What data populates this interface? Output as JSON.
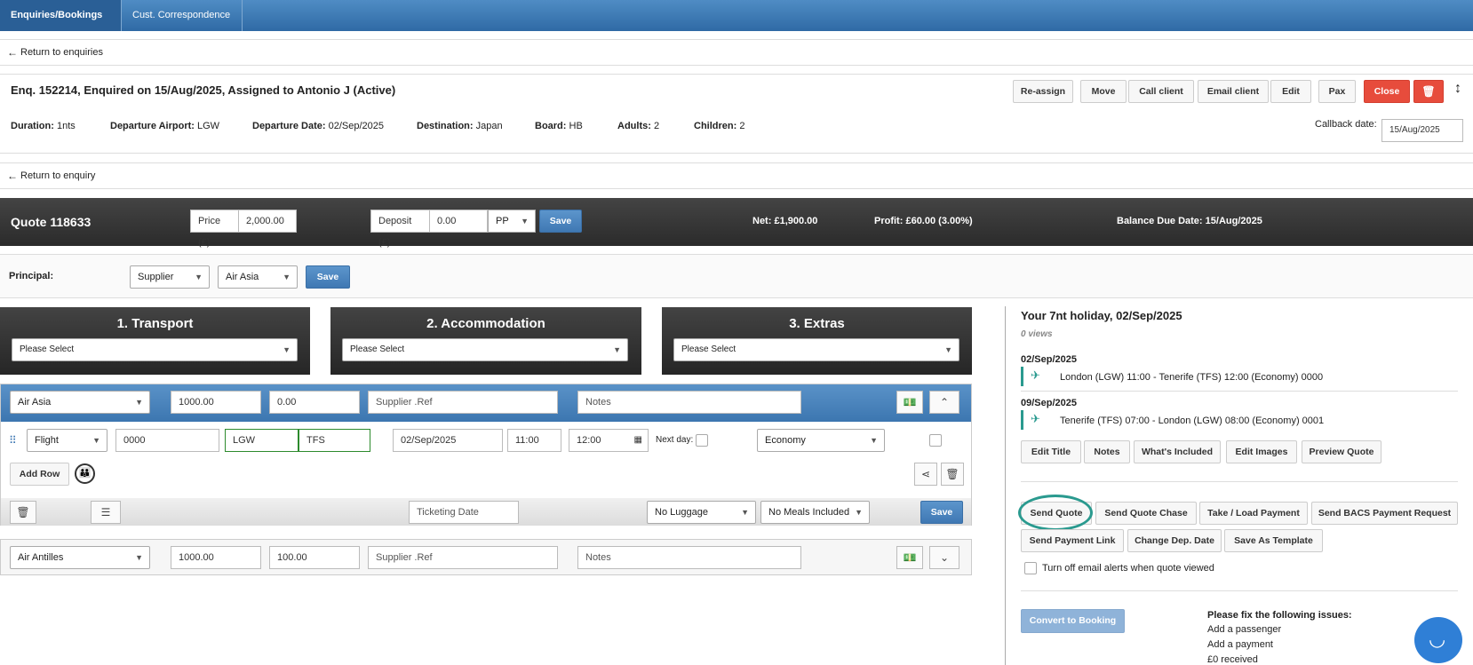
{
  "nav": {
    "tabs": [
      "Enquiries/Bookings",
      "Cust. Correspondence"
    ]
  },
  "return_enquiries": "Return to enquiries",
  "enquiry": {
    "title": "Enq. 152214, Enquired on 15/Aug/2025, Assigned to Antonio J (Active)",
    "buttons": [
      "Re-assign",
      "Move",
      "Call client",
      "Email client",
      "Edit",
      "Pax",
      "Close"
    ],
    "details": [
      {
        "label": "Duration:",
        "value": "1nts"
      },
      {
        "label": "Departure Airport:",
        "value": "LGW"
      },
      {
        "label": "Departure Date:",
        "value": "02/Sep/2025"
      },
      {
        "label": "Destination:",
        "value": "Japan"
      },
      {
        "label": "Board:",
        "value": "HB"
      },
      {
        "label": "Adults:",
        "value": "2"
      },
      {
        "label": "Children:",
        "value": "2"
      }
    ],
    "callback_label": "Callback date:",
    "callback_value": "15/Aug/2025"
  },
  "return_enquiry": "Return to enquiry",
  "quote": {
    "title": "Quote 118633",
    "price_label": "Price (£)",
    "price_value": "2,000.00",
    "deposit_label": "Deposit (£)",
    "deposit_value": "0.00",
    "deposit_type": "PP",
    "save": "Save",
    "net_label": "Net:",
    "net_value": "£1,900.00",
    "profit_label": "Profit:",
    "profit_value": "£60.00 (3.00%)",
    "balance_label": "Balance Due Date:",
    "balance_value": "15/Aug/2025"
  },
  "principal": {
    "label": "Principal:",
    "type": "Supplier",
    "value": "Air Asia",
    "save": "Save"
  },
  "sections": [
    {
      "title": "1. Transport",
      "select": "Please Select"
    },
    {
      "title": "2. Accommodation",
      "select": "Please Select"
    },
    {
      "title": "3. Extras",
      "select": "Please Select"
    }
  ],
  "flight1": {
    "supplier": "Air Asia",
    "net": "1000.00",
    "extra": "0.00",
    "ref_ph": "Supplier .Ref",
    "notes_ph": "Notes",
    "type": "Flight",
    "flight_no": "0000",
    "from": "LGW",
    "to": "TFS",
    "date": "02/Sep/2025",
    "dep": "11:00",
    "arr": "12:00",
    "next_day": "Next day:",
    "cabin": "Economy",
    "add_row": "Add Row",
    "ticketing_ph": "Ticketing Date",
    "luggage": "No Luggage",
    "meals": "No Meals Included",
    "save": "Save"
  },
  "flight2": {
    "supplier": "Air Antilles",
    "net": "1000.00",
    "extra": "100.00",
    "ref_ph": "Supplier .Ref",
    "notes_ph": "Notes"
  },
  "summary": {
    "title": "Your 7nt holiday, 02/Sep/2025",
    "views": "0 views",
    "legs": [
      {
        "date": "02/Sep/2025",
        "text": "London (LGW) 11:00 - Tenerife (TFS) 12:00 (Economy) 0000"
      },
      {
        "date": "09/Sep/2025",
        "text": "Tenerife (TFS) 07:00 - London (LGW) 08:00 (Economy) 0001"
      }
    ],
    "buttons1": [
      "Edit Title",
      "Notes",
      "What's Included",
      "Edit Images",
      "Preview Quote"
    ],
    "buttons2": [
      "Send Quote",
      "Send Quote Chase",
      "Take / Load Payment",
      "Send BACS Payment Request"
    ],
    "buttons3": [
      "Send Payment Link",
      "Change Dep. Date",
      "Save As Template"
    ],
    "email_alert": "Turn off email alerts when quote viewed",
    "convert": "Convert to Booking",
    "issues_title": "Please fix the following issues:",
    "issues": [
      "Add a passenger",
      "Add a payment",
      "£0 received"
    ]
  },
  "colors": {
    "accent": "#3f78b3",
    "danger": "#e74c3c",
    "highlight": "#2a9a8f"
  }
}
